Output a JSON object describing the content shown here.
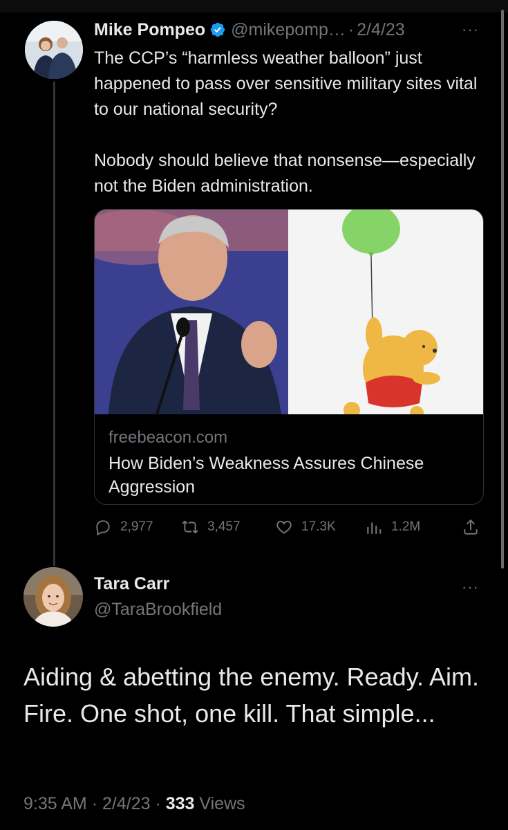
{
  "tweet1": {
    "name": "Mike Pompeo",
    "handle": "@mikepomp…",
    "separator": "·",
    "date": "2/4/23",
    "more": "···",
    "text": "The CCP’s “harmless weather balloon” just happened to pass over sensitive military sites vital to our national security?\n\nNobody should believe that nonsense—especially not the Biden administration.",
    "card": {
      "domain": "freebeacon.com",
      "title": "How Biden’s Weakness Assures Chinese Aggression"
    },
    "actions": {
      "replies": "2,977",
      "retweets": "3,457",
      "likes": "17.3K",
      "views": "1.2M"
    }
  },
  "tweet2": {
    "name": "Tara Carr",
    "handle": "@TaraBrookfield",
    "more": "···",
    "text": "Aiding & abetting the enemy. Ready. Aim. Fire. One shot, one kill. That simple...",
    "time": "9:35 AM",
    "separator": "·",
    "date": "2/4/23",
    "views_count": "333",
    "views_label": "Views"
  },
  "colors": {
    "background": "#000000",
    "text": "#e7e9ea",
    "secondary": "#71767b",
    "verified": "#1d9bf0",
    "border": "#2f3336"
  }
}
